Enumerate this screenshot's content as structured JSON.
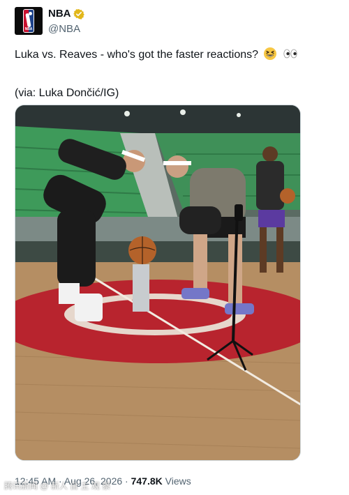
{
  "account": {
    "display_name": "NBA",
    "handle": "@NBA",
    "avatar_text": "NBA"
  },
  "tweet": {
    "text_line1": "Luka vs. Reaves - who's got the faster reactions?",
    "emojis": [
      "grinning-squinting-face",
      "eyes"
    ],
    "text_line2": "(via: Luka Dončić/IG)"
  },
  "media": {
    "description": "video frame"
  },
  "footer": {
    "time": "12:45 AM",
    "separator1": "·",
    "date": "Aug 26, 2026",
    "separator2": "·",
    "views_count": "747.8K",
    "views_label": "Views"
  },
  "watermark": {
    "text": "腾讯新闻 @ 新人 自 主 观 察"
  },
  "colors": {
    "text_primary": "#0f1419",
    "text_secondary": "#536471",
    "verified": "#f4b400",
    "court_red": "#b8242e",
    "court_wood": "#b58e63",
    "arena_green": "#3e9a5a"
  }
}
